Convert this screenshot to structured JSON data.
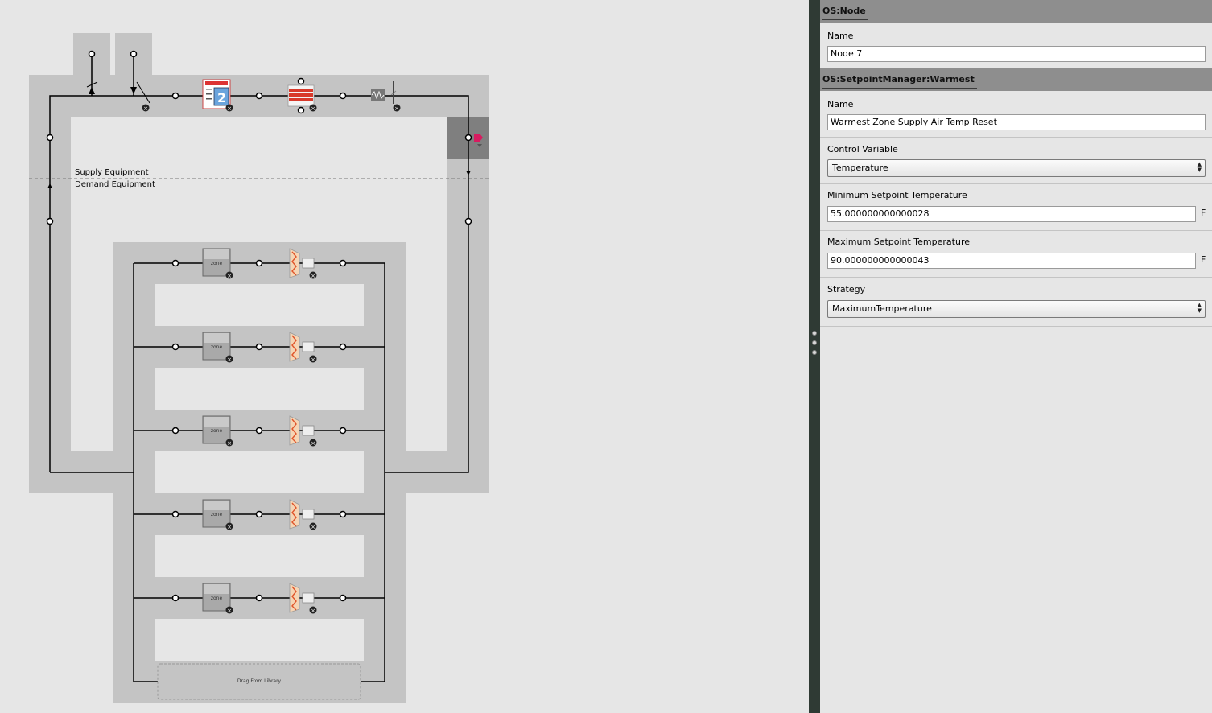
{
  "diagram": {
    "supply_label": "Supply Equipment",
    "demand_label": "Demand Equipment",
    "drag_label": "Drag From Library",
    "zone_label": "zone",
    "branch_count": 5
  },
  "inspector": {
    "node_section": {
      "title": "OS:Node",
      "name_label": "Name",
      "name_value": "Node 7"
    },
    "spm_section": {
      "title": "OS:SetpointManager:Warmest",
      "name_label": "Name",
      "name_value": "Warmest Zone Supply Air Temp Reset",
      "control_variable_label": "Control Variable",
      "control_variable_value": "Temperature",
      "min_temp_label": "Minimum Setpoint Temperature",
      "min_temp_value": "55.000000000000028",
      "min_temp_unit": "F",
      "max_temp_label": "Maximum Setpoint Temperature",
      "max_temp_value": "90.000000000000043",
      "max_temp_unit": "F",
      "strategy_label": "Strategy",
      "strategy_value": "MaximumTemperature"
    }
  },
  "colors": {
    "background": "#e6e6e6",
    "loop_band": "#c4c4c4",
    "splitter": "#2f3a34",
    "setpoint_marker": "#d81b60",
    "section_header": "#8e8e8e"
  }
}
